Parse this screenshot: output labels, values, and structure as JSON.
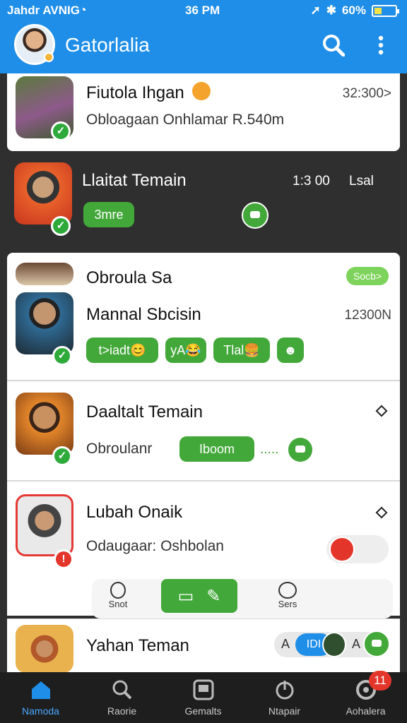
{
  "status": {
    "carrier": "Jahdr AVNIG",
    "time": "36 PM",
    "battery": "60%"
  },
  "app": {
    "title": "Gatorlalia"
  },
  "colors": {
    "primary": "#1f8ee8",
    "accent": "#43a83a",
    "badge": "#e4352b"
  },
  "chats": [
    {
      "name": "Fiutola Ihgan",
      "emoji": "smirk-face",
      "preview": "Obloagaan Onhlamar R.540m",
      "meta": "32:300>"
    },
    {
      "name": "Llaitat Temain",
      "meta": "1:3 00",
      "meta_tag": "Lsal",
      "chip": "3mre"
    },
    {
      "name": "Obroula Sa",
      "tag": "Socb>"
    },
    {
      "name": "Mannal Sbcisin",
      "meta": "12300N",
      "chips": [
        "t>iadt😊",
        "yA😂",
        "Tlal🍔"
      ]
    },
    {
      "name": "Daaltalt Temain",
      "preview": "Obroulanr",
      "chip": "Iboom",
      "dots": "....."
    },
    {
      "name": "Lubah Onaik",
      "preview": "Odaugaar: Oshbolan"
    },
    {
      "name": "Yahan Teman",
      "quick_chip": "IDI"
    }
  ],
  "quick_actions": {
    "left": "Snot",
    "right": "Sers"
  },
  "tabs": [
    {
      "label": "Namoda",
      "icon": "home-icon"
    },
    {
      "label": "Raorie",
      "icon": "search-icon"
    },
    {
      "label": "Gemalts",
      "icon": "games-icon"
    },
    {
      "label": "Ntapair",
      "icon": "power-icon"
    },
    {
      "label": "Aohalera",
      "icon": "profile-icon"
    }
  ],
  "badge_count": "11"
}
